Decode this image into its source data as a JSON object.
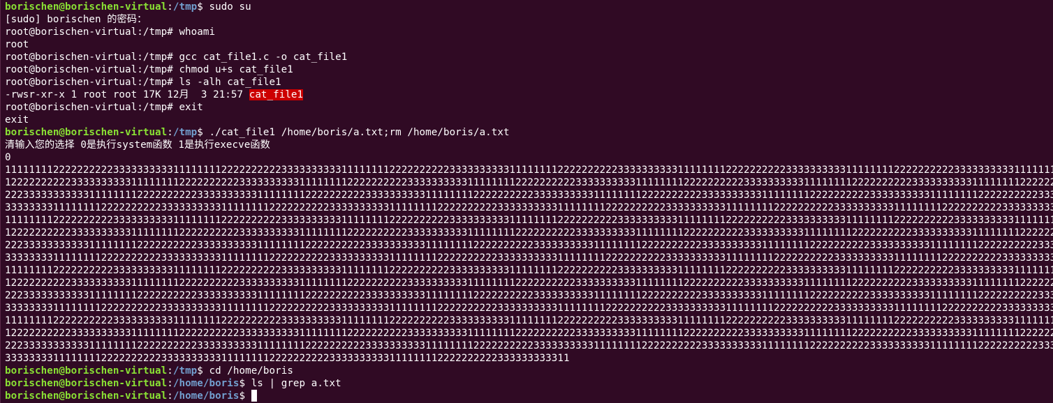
{
  "lines": [
    {
      "kind": "prompt",
      "user": "borischen@borischen-virtual",
      "colon": ":",
      "path": "/tmp",
      "dollar": "$ ",
      "cmd": "sudo su"
    },
    {
      "kind": "out",
      "text": "[sudo] borischen 的密码："
    },
    {
      "kind": "out",
      "text": "root@borischen-virtual:/tmp# whoami"
    },
    {
      "kind": "out",
      "text": "root"
    },
    {
      "kind": "out",
      "text": "root@borischen-virtual:/tmp# gcc cat_file1.c -o cat_file1"
    },
    {
      "kind": "out",
      "text": "root@borischen-virtual:/tmp# chmod u+s cat_file1"
    },
    {
      "kind": "out",
      "text": "root@borischen-virtual:/tmp# ls -alh cat_file1"
    },
    {
      "kind": "ls",
      "prefix": "-rwsr-xr-x 1 root root 17K 12月  3 21:57 ",
      "file": "cat_file1"
    },
    {
      "kind": "out",
      "text": "root@borischen-virtual:/tmp# exit"
    },
    {
      "kind": "out",
      "text": "exit"
    },
    {
      "kind": "prompt",
      "user": "borischen@borischen-virtual",
      "colon": ":",
      "path": "/tmp",
      "dollar": "$ ",
      "cmd": "./cat_file1 /home/boris/a.txt;rm /home/boris/a.txt"
    },
    {
      "kind": "out",
      "text": "清输入您的选择 0是执行system函数 1是执行execve函数"
    },
    {
      "kind": "out",
      "text": "0"
    },
    {
      "kind": "out",
      "text": "11111111222222222233333333331111111122222222223333333333111111112222222222333333333311111111222222222233333333331111111122222222223333333333111111112222222222333333333311111111222222222233333333"
    },
    {
      "kind": "out",
      "text": "12222222222333333333311111111222222222233333333331111111122222222223333333333111111112222222222333333333311111111222222222233333333331111111122222222223333333333111111112222222222333333333311111111"
    },
    {
      "kind": "out",
      "text": "22233333333333111111112222222222333333333311111111222222222233333333331111111122222222223333333333111111112222222222333333333311111111222222222233333333331111111122222222223333333333111111112222222"
    },
    {
      "kind": "out",
      "text": "33333333111111112222222222333333333311111111222222222233333333331111111122222222223333333333111111112222222222333333333311111111222222222233333333331111111122222222223333333333111111112222222222333"
    },
    {
      "kind": "out",
      "text": "11111111222222222233333333331111111122222222223333333333111111112222222222333333333311111111222222222233333333331111111122222222223333333333111111112222222222333333333311111111222222222233333333"
    },
    {
      "kind": "out",
      "text": "12222222222333333333311111111222222222233333333331111111122222222223333333333111111112222222222333333333311111111222222222233333333331111111122222222223333333333111111112222222222333333333311111111"
    },
    {
      "kind": "out",
      "text": "22233333333333111111112222222222333333333311111111222222222233333333331111111122222222223333333333111111112222222222333333333311111111222222222233333333331111111122222222223333333333111111112222222"
    },
    {
      "kind": "out",
      "text": "33333333111111112222222222333333333311111111222222222233333333331111111122222222223333333333111111112222222222333333333311111111222222222233333333331111111122222222223333333333111111112222222222333"
    },
    {
      "kind": "out",
      "text": "11111111222222222233333333331111111122222222223333333333111111112222222222333333333311111111222222222233333333331111111122222222223333333333111111112222222222333333333311111111222222222233333333"
    },
    {
      "kind": "out",
      "text": "12222222222333333333311111111222222222233333333331111111122222222223333333333111111112222222222333333333311111111222222222233333333331111111122222222223333333333111111112222222222333333333311111111"
    },
    {
      "kind": "out",
      "text": "22233333333333111111112222222222333333333311111111222222222233333333331111111122222222223333333333111111112222222222333333333311111111222222222233333333331111111122222222223333333333111111112222222"
    },
    {
      "kind": "out",
      "text": "33333333111111112222222222333333333311111111222222222233333333331111111122222222223333333333111111112222222222333333333311111111222222222233333333331111111122222222223333333333111111112222222222333"
    },
    {
      "kind": "out",
      "text": "11111111222222222233333333331111111122222222223333333333111111112222222222333333333311111111222222222233333333331111111122222222223333333333111111112222222222333333333311111111222222222233333333"
    },
    {
      "kind": "out",
      "text": "12222222222333333333311111111222222222233333333331111111122222222223333333333111111112222222222333333333311111111222222222233333333331111111122222222223333333333111111112222222222333333333311111111"
    },
    {
      "kind": "out",
      "text": "22233333333333111111112222222222333333333311111111222222222233333333331111111122222222223333333333111111112222222222333333333311111111222222222233333333331111111122222222223333333333111111112222222"
    },
    {
      "kind": "out",
      "text": "3333333311111111222222222233333333331111111122222222223333333333111111112222222222333333333311"
    },
    {
      "kind": "prompt",
      "user": "borischen@borischen-virtual",
      "colon": ":",
      "path": "/tmp",
      "dollar": "$ ",
      "cmd": "cd /home/boris"
    },
    {
      "kind": "prompt",
      "user": "borischen@borischen-virtual",
      "colon": ":",
      "path": "/home/boris",
      "dollar": "$ ",
      "cmd": "ls | grep a.txt"
    },
    {
      "kind": "prompt-cursor",
      "user": "borischen@borischen-virtual",
      "colon": ":",
      "path": "/home/boris",
      "dollar": "$ ",
      "cmd": ""
    }
  ],
  "colors": {
    "background": "#300a24",
    "foreground": "#ffffff",
    "prompt_user": "#8ae234",
    "prompt_path": "#729fcf",
    "exec_highlight": "#cc0000"
  }
}
